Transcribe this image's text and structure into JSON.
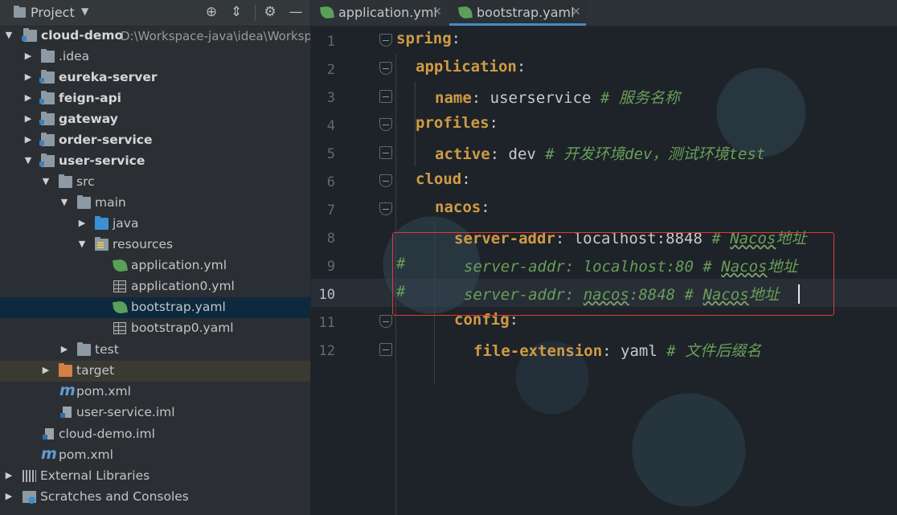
{
  "project_panel": {
    "title": "Project",
    "tree": [
      {
        "label": "cloud-demo",
        "path": "D:\\Workspace-java\\idea\\Worksp"
      },
      {
        "label": ".idea"
      },
      {
        "label": "eureka-server"
      },
      {
        "label": "feign-api"
      },
      {
        "label": "gateway"
      },
      {
        "label": "order-service"
      },
      {
        "label": "user-service"
      },
      {
        "label": "src"
      },
      {
        "label": "main"
      },
      {
        "label": "java"
      },
      {
        "label": "resources"
      },
      {
        "label": "application.yml"
      },
      {
        "label": "application0.yml"
      },
      {
        "label": "bootstrap.yaml"
      },
      {
        "label": "bootstrap0.yaml"
      },
      {
        "label": "test"
      },
      {
        "label": "target"
      },
      {
        "label": "pom.xml"
      },
      {
        "label": "user-service.iml"
      },
      {
        "label": "cloud-demo.iml"
      },
      {
        "label": "pom.xml"
      },
      {
        "label": "External Libraries"
      },
      {
        "label": "Scratches and Consoles"
      }
    ]
  },
  "editor": {
    "tabs": [
      {
        "label": "application.yml",
        "active": false
      },
      {
        "label": "bootstrap.yaml",
        "active": true
      }
    ],
    "line_numbers": [
      "1",
      "2",
      "3",
      "4",
      "5",
      "6",
      "7",
      "8",
      "9",
      "10",
      "11",
      "12"
    ],
    "current_line": "10",
    "lines": [
      {
        "key": "spring",
        "colon": ":",
        "value": "",
        "comment": ""
      },
      {
        "key": "application",
        "colon": ":",
        "value": "",
        "comment": ""
      },
      {
        "key": "name",
        "colon": ":",
        "value": " userservice",
        "comment": " # 服务名称"
      },
      {
        "key": "profiles",
        "colon": ":",
        "value": "",
        "comment": ""
      },
      {
        "key": "active",
        "colon": ":",
        "value": " dev",
        "comment": " # 开发环境dev，测试环境test"
      },
      {
        "key": "cloud",
        "colon": ":",
        "value": "",
        "comment": ""
      },
      {
        "key": "nacos",
        "colon": ":",
        "value": "",
        "comment": ""
      },
      {
        "key": "server-addr",
        "colon": ":",
        "value": " localhost:8848",
        "comment": " # ",
        "comment_word": "Nacos",
        "comment_tail": "地址"
      },
      {
        "hash": "#",
        "text": "server-addr: localhost:80 # ",
        "comment_word": "Nacos",
        "comment_tail": "地址"
      },
      {
        "hash": "#",
        "text": "server-addr: ",
        "mid_word": "nacos",
        "text2": ":8848 # ",
        "comment_word": "Nacos",
        "comment_tail": "地址"
      },
      {
        "key": "config",
        "colon": ":",
        "value": "",
        "comment": ""
      },
      {
        "key": "file-extension",
        "colon": ":",
        "value": " yaml",
        "comment": " # 文件后缀名"
      }
    ]
  },
  "colors": {
    "key": "#d19a45",
    "comment": "#6a9e5a",
    "selection": "#0d293e",
    "highlight_border": "#e03a3a",
    "active_tab_underline": "#4a88c7"
  }
}
